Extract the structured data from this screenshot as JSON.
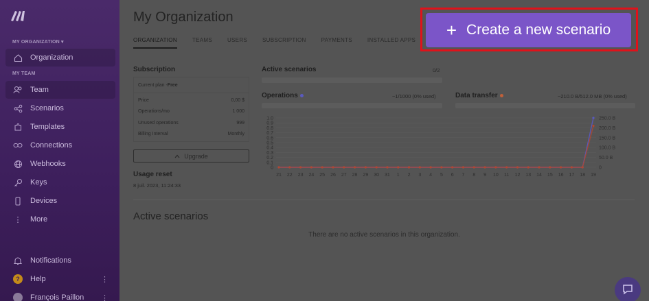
{
  "sidebar": {
    "org_label": "MY ORGANIZATION ▾",
    "organization_item": "Organization",
    "team_label": "MY TEAM",
    "items": [
      {
        "label": "Team",
        "icon": "users-icon"
      },
      {
        "label": "Scenarios",
        "icon": "share-icon"
      },
      {
        "label": "Templates",
        "icon": "puzzle-icon"
      },
      {
        "label": "Connections",
        "icon": "link-icon"
      },
      {
        "label": "Webhooks",
        "icon": "globe-icon"
      },
      {
        "label": "Keys",
        "icon": "key-icon"
      },
      {
        "label": "Devices",
        "icon": "phone-icon"
      },
      {
        "label": "More",
        "icon": "more-icon"
      }
    ],
    "notifications": "Notifications",
    "help": "Help",
    "user": "François Paillon"
  },
  "header": {
    "title": "My Organization",
    "tabs": [
      "ORGANIZATION",
      "TEAMS",
      "USERS",
      "SUBSCRIPTION",
      "PAYMENTS",
      "INSTALLED APPS",
      "V"
    ],
    "create_button": "Create a new scenario"
  },
  "subscription": {
    "heading": "Subscription",
    "current_plan_label": "Current plan - ",
    "current_plan_value": "Free",
    "rows": [
      {
        "label": "Price",
        "value": "0,00 $"
      },
      {
        "label": "Operations/mo",
        "value": "1 000"
      },
      {
        "label": "Unused operations",
        "value": "999"
      },
      {
        "label": "Billing Interval",
        "value": "Monthly"
      }
    ],
    "upgrade_label": "Upgrade"
  },
  "usage_reset": {
    "heading": "Usage reset",
    "date": "8 juil. 2023, 11:24:33"
  },
  "active_scenarios_stat": {
    "heading": "Active scenarios",
    "value": "0/2"
  },
  "operations": {
    "heading": "Operations",
    "usage": "~1/1000 (0% used)",
    "color": "#5a5abf"
  },
  "data_transfer": {
    "heading": "Data transfer",
    "usage": "~210.0 B/512.0 MB (0% used)",
    "color": "#c0603a"
  },
  "chart_data": {
    "type": "line",
    "x": [
      "21",
      "22",
      "23",
      "24",
      "25",
      "26",
      "27",
      "28",
      "29",
      "30",
      "31",
      "1",
      "2",
      "3",
      "4",
      "5",
      "6",
      "7",
      "8",
      "9",
      "10",
      "11",
      "12",
      "13",
      "14",
      "15",
      "16",
      "17",
      "18",
      "19"
    ],
    "left_ticks": [
      "1.0",
      "0.9",
      "0.8",
      "0.7",
      "0.6",
      "0.5",
      "0.4",
      "0.3",
      "0.2",
      "0.1",
      "0"
    ],
    "right_ticks": [
      "250.0 B",
      "200.0 B",
      "150.0 B",
      "100.0 B",
      "50.0 B",
      "0"
    ],
    "series": [
      {
        "name": "Operations",
        "axis": "left",
        "color": "#5a5abf",
        "values": [
          0,
          0,
          0,
          0,
          0,
          0,
          0,
          0,
          0,
          0,
          0,
          0,
          0,
          0,
          0,
          0,
          0,
          0,
          0,
          0,
          0,
          0,
          0,
          0,
          0,
          0,
          0,
          0,
          0,
          1
        ]
      },
      {
        "name": "Data transfer",
        "axis": "right",
        "color": "#b04830",
        "values": [
          0,
          0,
          0,
          0,
          0,
          0,
          0,
          0,
          0,
          0,
          0,
          0,
          0,
          0,
          0,
          0,
          0,
          0,
          0,
          0,
          0,
          0,
          0,
          0,
          0,
          0,
          0,
          0,
          0,
          210
        ]
      }
    ],
    "ylim_left": [
      0,
      1
    ],
    "ylim_right": [
      0,
      250
    ]
  },
  "active_section": {
    "heading": "Active scenarios",
    "empty_message": "There are no active scenarios in this organization."
  }
}
